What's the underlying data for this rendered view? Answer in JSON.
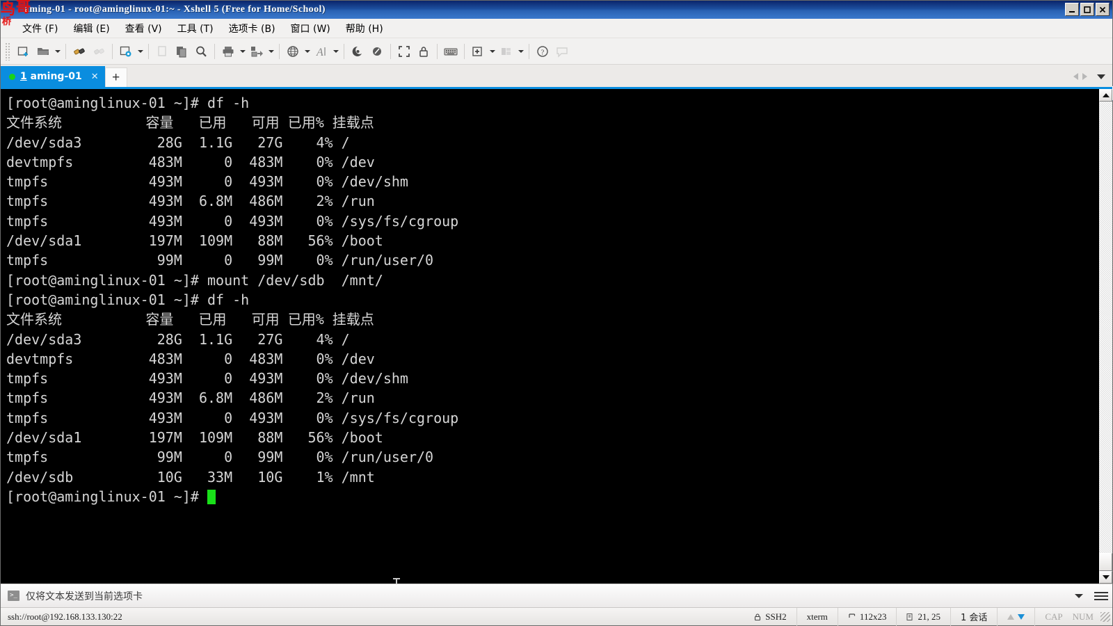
{
  "window": {
    "title": "aming-01 - root@aminglinux-01:~ - Xshell 5 (Free for Home/School)",
    "minimize_label": "_",
    "maximize_label": "□",
    "close_label": "✕",
    "watermark": {
      "char1": "鸟",
      "char2": "哥",
      "char3": "桥"
    }
  },
  "menu": {
    "items": [
      {
        "label": "文件 (F)",
        "name": "menu-file"
      },
      {
        "label": "编辑 (E)",
        "name": "menu-edit"
      },
      {
        "label": "查看 (V)",
        "name": "menu-view"
      },
      {
        "label": "工具 (T)",
        "name": "menu-tools"
      },
      {
        "label": "选项卡 (B)",
        "name": "menu-tabs"
      },
      {
        "label": "窗口 (W)",
        "name": "menu-window"
      },
      {
        "label": "帮助 (H)",
        "name": "menu-help"
      }
    ]
  },
  "toolbar": {
    "input_value": "",
    "input_placeholder": "",
    "buttons": [
      "new-session-icon",
      "open-folder-icon",
      "connect-icon",
      "disconnect-icon",
      "session-properties-icon",
      "copy-page-icon",
      "paste-icon",
      "find-icon",
      "print-icon",
      "transfer-icon",
      "web-icon",
      "font-icon",
      "xshell-icon",
      "xftp-icon",
      "fullscreen-icon",
      "lock-icon",
      "keyboard-icon",
      "add-to-folder-icon",
      "layout-icon",
      "help-icon",
      "comment-icon"
    ]
  },
  "tabs": {
    "active": {
      "index": "1",
      "label": "aming-01",
      "close_label": "✕",
      "status": "connected"
    },
    "add_label": "+"
  },
  "terminal": {
    "lines": [
      "[root@aminglinux-01 ~]# df -h",
      "文件系统          容量   已用   可用 已用% 挂载点",
      "/dev/sda3         28G  1.1G   27G    4% /",
      "devtmpfs         483M     0  483M    0% /dev",
      "tmpfs            493M     0  493M    0% /dev/shm",
      "tmpfs            493M  6.8M  486M    2% /run",
      "tmpfs            493M     0  493M    0% /sys/fs/cgroup",
      "/dev/sda1        197M  109M   88M   56% /boot",
      "tmpfs             99M     0   99M    0% /run/user/0",
      "[root@aminglinux-01 ~]# mount /dev/sdb  /mnt/",
      "[root@aminglinux-01 ~]# df -h",
      "文件系统          容量   已用   可用 已用% 挂载点",
      "/dev/sda3         28G  1.1G   27G    4% /",
      "devtmpfs         483M     0  483M    0% /dev",
      "tmpfs            493M     0  493M    0% /dev/shm",
      "tmpfs            493M  6.8M  486M    2% /run",
      "tmpfs            493M     0  493M    0% /sys/fs/cgroup",
      "/dev/sda1        197M  109M   88M   56% /boot",
      "tmpfs             99M     0   99M    0% /run/user/0",
      "/dev/sdb          10G   33M   10G    1% /mnt"
    ],
    "prompt": "[root@aminglinux-01 ~]# ",
    "background": "#000000",
    "foreground": "#d6d6d6",
    "cursor_color": "#19e019"
  },
  "command_bar": {
    "label": "仅将文本发送到当前选项卡",
    "icon": "terminal-prompt-icon"
  },
  "statusbar": {
    "url": "ssh://root@192.168.133.130:22",
    "protocol": "SSH2",
    "term_type": "xterm",
    "size": "112x23",
    "cursor_pos": "21, 25",
    "sessions": "1 会话",
    "caps": "CAP",
    "num": "NUM"
  }
}
